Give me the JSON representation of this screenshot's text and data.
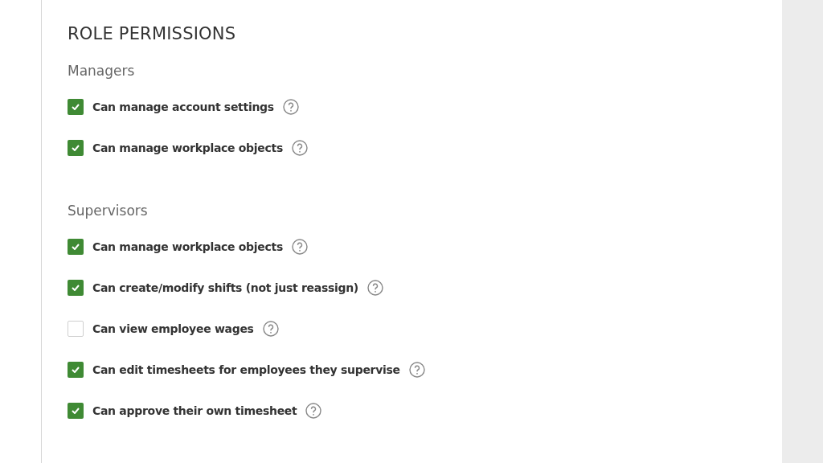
{
  "title": "ROLE PERMISSIONS",
  "groups": [
    {
      "name": "Managers",
      "permissions": [
        {
          "label": "Can manage account settings",
          "checked": true
        },
        {
          "label": "Can manage workplace objects",
          "checked": true
        }
      ]
    },
    {
      "name": "Supervisors",
      "permissions": [
        {
          "label": "Can manage workplace objects",
          "checked": true
        },
        {
          "label": "Can create/modify shifts (not just reassign)",
          "checked": true
        },
        {
          "label": "Can view employee wages",
          "checked": false
        },
        {
          "label": "Can edit timesheets for employees they supervise",
          "checked": true
        },
        {
          "label": "Can approve their own timesheet",
          "checked": true
        }
      ]
    }
  ]
}
